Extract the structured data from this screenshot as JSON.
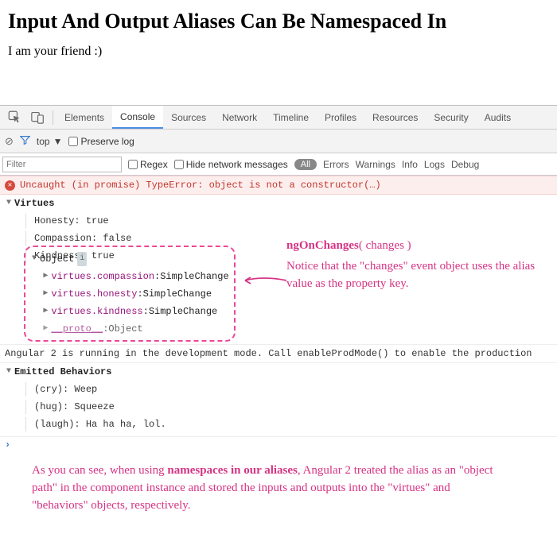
{
  "page": {
    "title": "Input And Output Aliases Can Be Namespaced In",
    "subtext": "I am your friend :)"
  },
  "tabs": {
    "items": [
      "Elements",
      "Console",
      "Sources",
      "Network",
      "Timeline",
      "Profiles",
      "Resources",
      "Security",
      "Audits"
    ],
    "active": "Console"
  },
  "toolbar": {
    "context": "top",
    "preserve_label": "Preserve log"
  },
  "filterbar": {
    "placeholder": "Filter",
    "regex_label": "Regex",
    "hide_label": "Hide network messages",
    "levels": [
      "All",
      "Errors",
      "Warnings",
      "Info",
      "Logs",
      "Debug"
    ]
  },
  "console": {
    "error": "Uncaught (in promise) TypeError: object is not a constructor(…)",
    "group1": {
      "label": "Virtues",
      "rows": [
        {
          "k": "Honesty",
          "v": "true"
        },
        {
          "k": "Compassion",
          "v": "false"
        },
        {
          "k": "Kindness",
          "v": "true"
        }
      ],
      "obj": {
        "label": "Object",
        "rows": [
          {
            "k": "virtues.compassion",
            "v": "SimpleChange"
          },
          {
            "k": "virtues.honesty",
            "v": "SimpleChange"
          },
          {
            "k": "virtues.kindness",
            "v": "SimpleChange"
          },
          {
            "k": "__proto__",
            "v": "Object"
          }
        ]
      }
    },
    "mode_msg": "Angular 2 is running in the development mode. Call enableProdMode() to enable the production",
    "group2": {
      "label": "Emitted Behaviors",
      "rows": [
        {
          "k": "(cry)",
          "v": "Weep"
        },
        {
          "k": "(hug)",
          "v": "Squeeze"
        },
        {
          "k": "(laugh)",
          "v": "Ha ha ha, lol."
        }
      ]
    }
  },
  "annot": {
    "r1": "ngOnChanges",
    "r1b": "( changes )",
    "r2": "Notice that the \"changes\" event object uses the alias value as the property key.",
    "b1a": "As you can see, when using ",
    "b1b": "namespaces in our aliases",
    "b1c": ", Angular 2 treated the alias as an \"object path\" in the component instance and stored the inputs and outputs into the \"virtues\" and \"behaviors\" objects, respectively."
  }
}
